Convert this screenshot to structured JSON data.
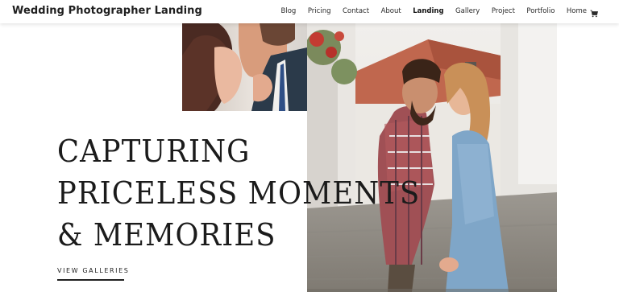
{
  "header": {
    "site_title": "Wedding Photographer Landing",
    "nav": [
      {
        "label": "Blog"
      },
      {
        "label": "Pricing"
      },
      {
        "label": "Contact"
      },
      {
        "label": "About"
      },
      {
        "label": "Landing",
        "active": true
      },
      {
        "label": "Gallery"
      },
      {
        "label": "Project"
      },
      {
        "label": "Portfolio"
      },
      {
        "label": "Home"
      }
    ],
    "cart_icon": "shopping-cart-icon"
  },
  "hero": {
    "line1": "CAPTURING",
    "line2": "PRICELESS MOMENTS",
    "line3": "& MEMORIES",
    "cta_label": "VIEW GALLERIES"
  },
  "colors": {
    "text": "#1b1b1b",
    "background": "#ffffff"
  }
}
